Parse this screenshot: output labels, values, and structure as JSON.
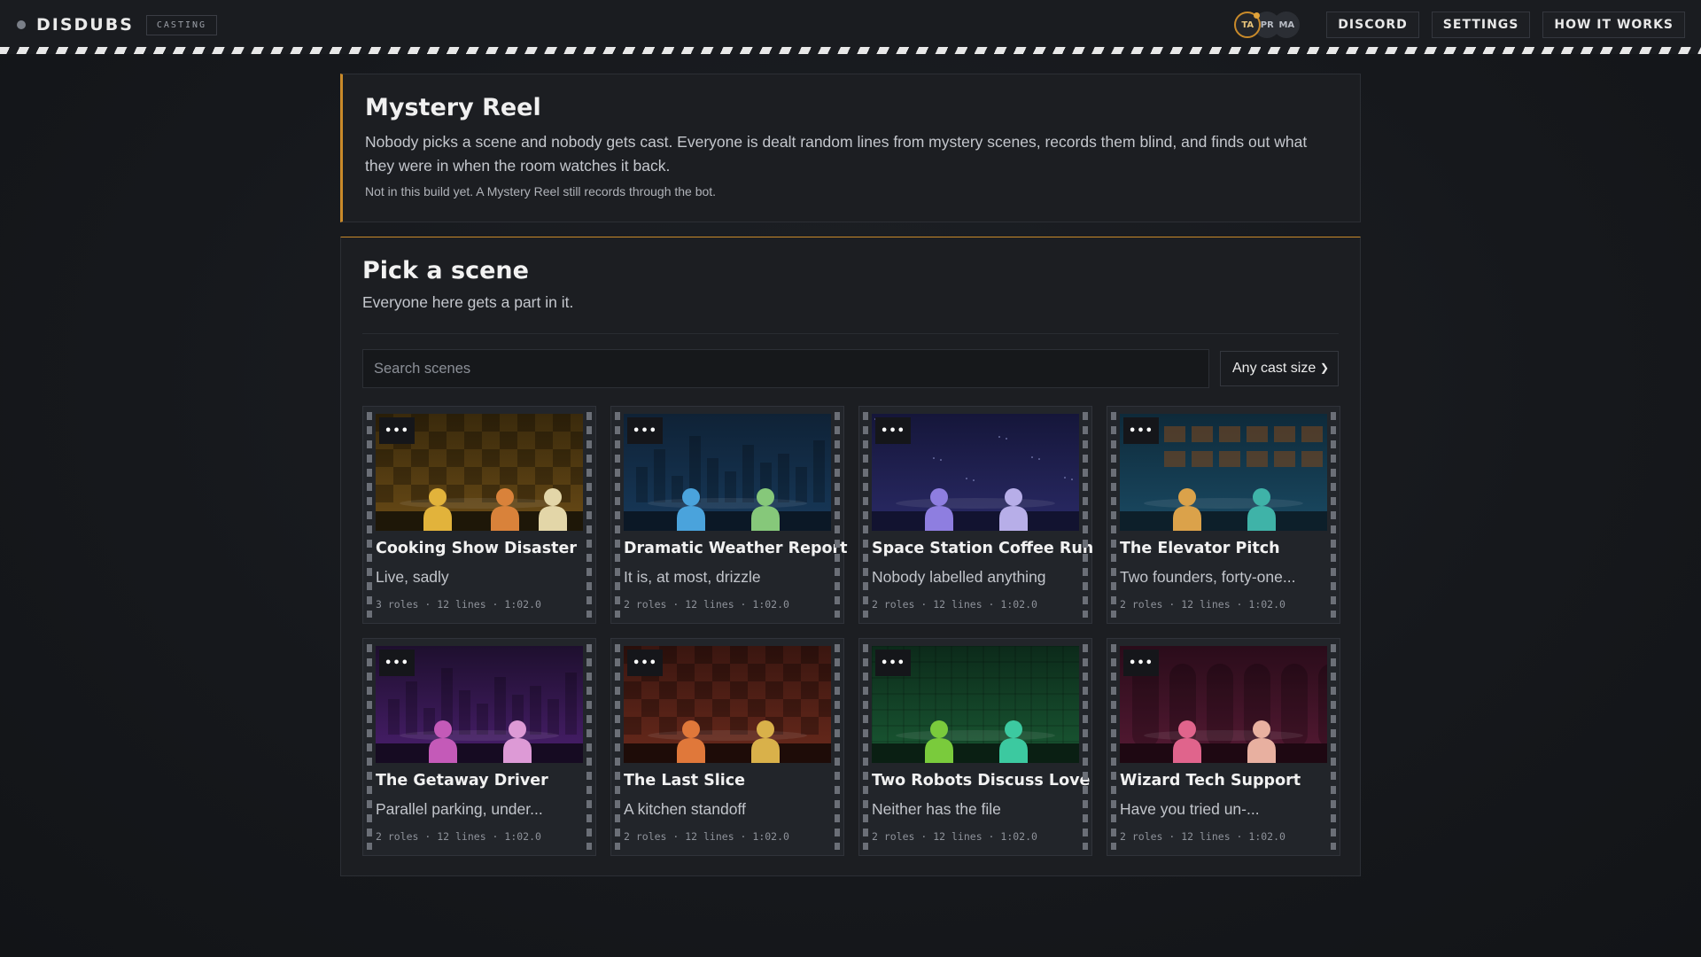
{
  "header": {
    "brand": "DISDUBS",
    "badge": "CASTING",
    "avatars": [
      "TA",
      "PR",
      "MA"
    ],
    "nav": [
      "DISCORD",
      "SETTINGS",
      "HOW IT WORKS"
    ],
    "accent": "#c98a2a"
  },
  "mystery": {
    "title": "Mystery Reel",
    "description": "Nobody picks a scene and nobody gets cast. Everyone is dealt random lines from mystery scenes, records them blind, and finds out what they were in when the room watches it back.",
    "note": "Not in this build yet. A Mystery Reel still records through the bot."
  },
  "picker": {
    "title": "Pick a scene",
    "subtitle": "Everyone here gets a part in it.",
    "search_placeholder": "Search scenes",
    "cast_size": "Any cast size"
  },
  "scenes": [
    {
      "title": "Cooking Show Disaster",
      "tagline": "Live, sadly",
      "meta": "3 roles · 12 lines · 1:02.0",
      "more": "•••",
      "theme": "checker",
      "bg": [
        "#3a2a0c",
        "#6a4b16"
      ],
      "floor": "#1e1708",
      "chars": [
        "#e2b33b",
        "#d9823a",
        "#e3d6a8"
      ]
    },
    {
      "title": "Dramatic Weather Report",
      "tagline": "It is, at most, drizzle",
      "meta": "2 roles · 12 lines · 1:02.0",
      "more": "•••",
      "theme": "city",
      "bg": [
        "#0f2236",
        "#17395a"
      ],
      "floor": "#0b1826",
      "chars": [
        "#4aa3dc",
        "#86c87a"
      ]
    },
    {
      "title": "Space Station Coffee Run",
      "tagline": "Nobody labelled anything",
      "meta": "2 roles · 12 lines · 1:02.0",
      "more": "•••",
      "theme": "space",
      "bg": [
        "#15163a",
        "#2a2a66"
      ],
      "floor": "#121330",
      "chars": [
        "#8e7ee0",
        "#b7aee8"
      ]
    },
    {
      "title": "The Elevator Pitch",
      "tagline": "Two founders, forty-one...",
      "meta": "2 roles · 12 lines · 1:02.0",
      "more": "•••",
      "theme": "windows",
      "bg": [
        "#0e2a3a",
        "#1a4a63"
      ],
      "floor": "#0d1f2a",
      "chars": [
        "#dba24a",
        "#3fb3a8"
      ]
    },
    {
      "title": "The Getaway Driver",
      "tagline": "Parallel parking, under...",
      "meta": "2 roles · 12 lines · 1:02.0",
      "more": "•••",
      "theme": "city",
      "bg": [
        "#1e0f2e",
        "#4a1f6e"
      ],
      "floor": "#160b22",
      "chars": [
        "#c45ab8",
        "#dd9ad6"
      ]
    },
    {
      "title": "The Last Slice",
      "tagline": "A kitchen standoff",
      "meta": "2 roles · 12 lines · 1:02.0",
      "more": "•••",
      "theme": "checker",
      "bg": [
        "#3a1610",
        "#6a2a1c"
      ],
      "floor": "#1e0c08",
      "chars": [
        "#e0783a",
        "#d9b14a"
      ]
    },
    {
      "title": "Two Robots Discuss Love",
      "tagline": "Neither has the file",
      "meta": "2 roles · 12 lines · 1:02.0",
      "more": "•••",
      "theme": "gridlines",
      "bg": [
        "#0c2a1a",
        "#1a5a34"
      ],
      "floor": "#0a1f13",
      "chars": [
        "#7acb3c",
        "#3cc9a0"
      ]
    },
    {
      "title": "Wizard Tech Support",
      "tagline": "Have you tried un-...",
      "meta": "2 roles · 12 lines · 1:02.0",
      "more": "•••",
      "theme": "arches",
      "bg": [
        "#2a0c1a",
        "#561a34"
      ],
      "floor": "#1e0812",
      "chars": [
        "#e0648c",
        "#e8b0a0"
      ]
    }
  ]
}
